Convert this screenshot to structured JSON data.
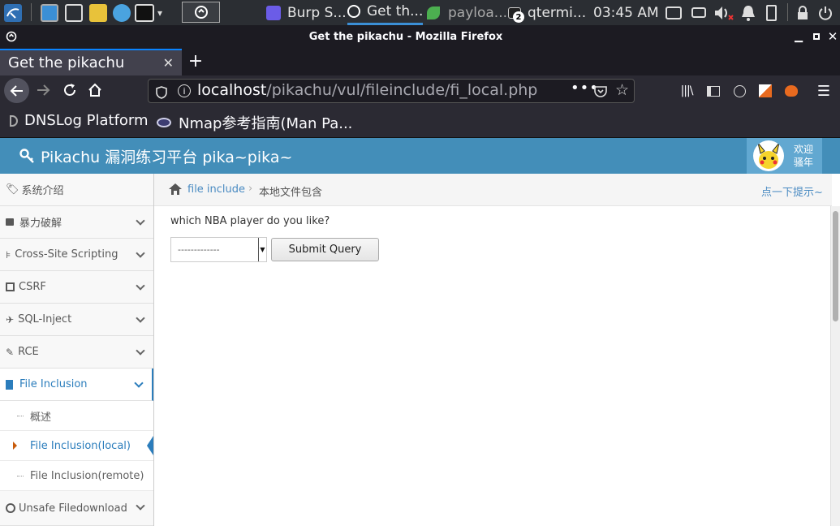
{
  "taskbar": {
    "apps": [
      "Burp S...",
      "Get th...",
      "payloa...",
      "qtermi..."
    ],
    "badge": "2",
    "time": "03:45 AM"
  },
  "window": {
    "title": "Get the pikachu - Mozilla Firefox"
  },
  "tab": {
    "title": "Get the pikachu"
  },
  "url": {
    "host": "localhost",
    "path": "/pikachu/vul/fileinclude/fi_local.php"
  },
  "bookmarks": [
    "DNSLog Platform",
    "Nmap参考指南(Man Pa..."
  ],
  "site": {
    "title": "Pikachu 漏洞练习平台 pika~pika~",
    "user_line1": "欢迎",
    "user_line2": "骚年"
  },
  "sidebar": {
    "items": [
      {
        "label": "系统介绍"
      },
      {
        "label": "暴力破解"
      },
      {
        "label": "Cross-Site Scripting"
      },
      {
        "label": "CSRF"
      },
      {
        "label": "SQL-Inject"
      },
      {
        "label": "RCE"
      },
      {
        "label": "File Inclusion"
      },
      {
        "label": "Unsafe Filedownload"
      }
    ],
    "subitems": [
      {
        "label": "概述"
      },
      {
        "label": "File Inclusion(local)"
      },
      {
        "label": "File Inclusion(remote)"
      }
    ]
  },
  "breadcrumb": {
    "link": "file include",
    "current": "本地文件包含",
    "hint": "点一下提示~"
  },
  "main": {
    "question": "which NBA player do you like?",
    "select_value": "-------------",
    "submit_label": "Submit Query"
  },
  "colors": {
    "header": "#438eb9",
    "link": "#4a8bc2",
    "active_sidebar": "#2b7dbc"
  }
}
